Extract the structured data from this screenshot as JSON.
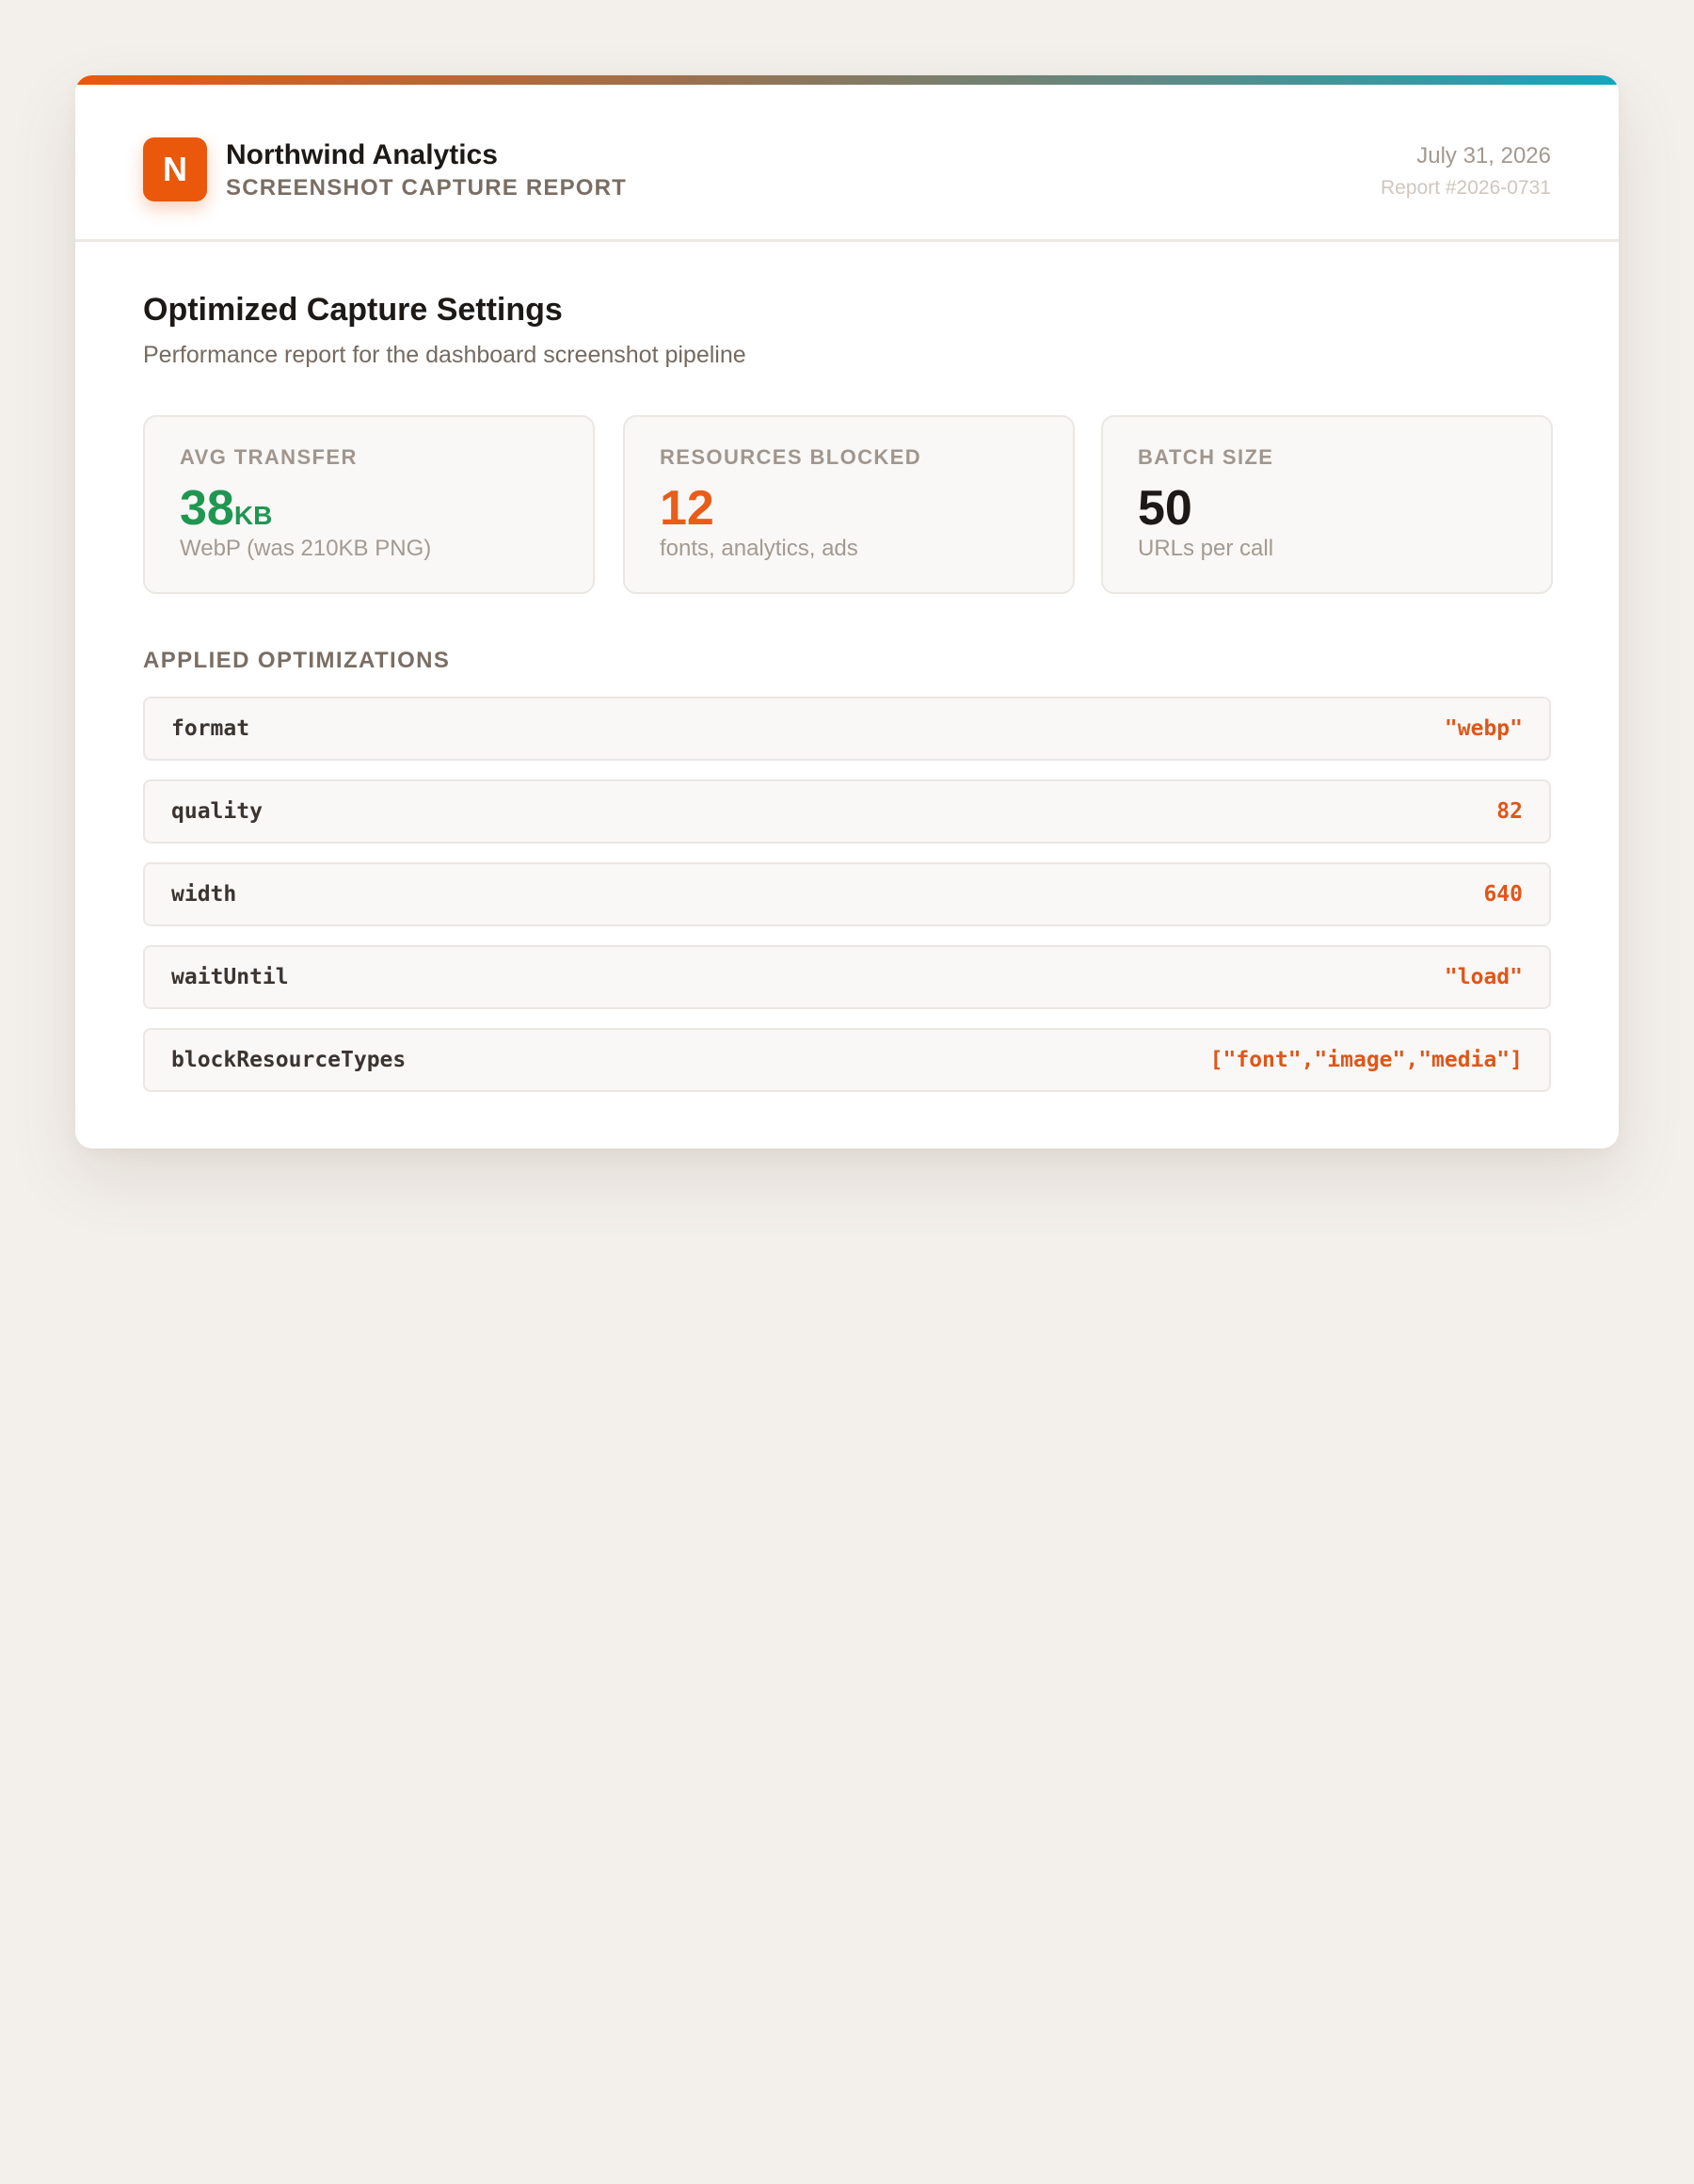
{
  "brand": {
    "logo_letter": "N",
    "name": "Northwind Analytics",
    "subtitle": "SCREENSHOT CAPTURE REPORT"
  },
  "report": {
    "date": "July 31, 2026",
    "id": "Report #2026-0731"
  },
  "page": {
    "title": "Optimized Capture Settings",
    "subtitle": "Performance report for the dashboard screenshot pipeline"
  },
  "stats": [
    {
      "label": "AVG TRANSFER",
      "value": "38",
      "unit": "KB",
      "note": "WebP (was 210KB PNG)",
      "color": "#1f9651"
    },
    {
      "label": "RESOURCES BLOCKED",
      "value": "12",
      "unit": "",
      "note": "fonts, analytics, ads",
      "color": "#e85d19"
    },
    {
      "label": "BATCH SIZE",
      "value": "50",
      "unit": "",
      "note": "URLs per call",
      "color": "#1c1917"
    }
  ],
  "optimizations": {
    "title": "APPLIED OPTIMIZATIONS",
    "items": [
      {
        "key": "format",
        "value": "\"webp\""
      },
      {
        "key": "quality",
        "value": "82"
      },
      {
        "key": "width",
        "value": "640"
      },
      {
        "key": "waitUntil",
        "value": "\"load\""
      },
      {
        "key": "blockResourceTypes",
        "value": "[\"font\",\"image\",\"media\"]"
      }
    ]
  },
  "colors": {
    "accent": "#ea580c",
    "accent_end": "#14a6bd",
    "background": "#f3efeb",
    "value_text": "#e0561a"
  }
}
